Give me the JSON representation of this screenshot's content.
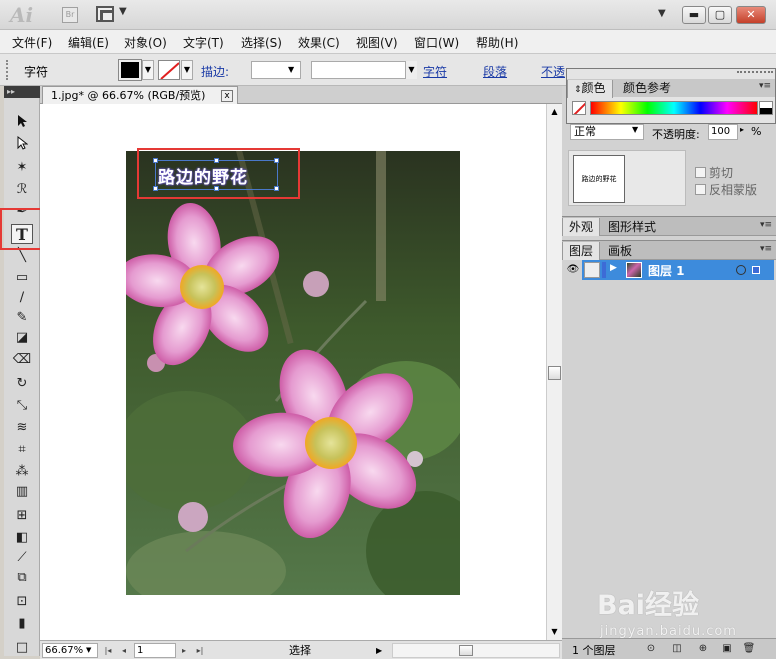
{
  "app": {
    "logo": "Ai",
    "bridge_label": "Br"
  },
  "menu": [
    "文件(F)",
    "编辑(E)",
    "对象(O)",
    "文字(T)",
    "选择(S)",
    "效果(C)",
    "视图(V)",
    "窗口(W)",
    "帮助(H)"
  ],
  "controlbar": {
    "label": "字符",
    "stroke_label": "描边:",
    "char_link": "字符",
    "para_link": "段落",
    "opacity_link": "不透"
  },
  "document": {
    "tab_title": "1.jpg* @ 66.67% (RGB/预览)",
    "close_glyph": "x",
    "text_object": "路边的野花"
  },
  "statusbar": {
    "zoom": "66.67%",
    "page": "1",
    "tool": "选择"
  },
  "panels": {
    "color_tabs": [
      "颜色",
      "颜色参考"
    ],
    "transparency": {
      "blend_mode": "正常",
      "opacity_label": "不透明度:",
      "opacity_value": "100",
      "opacity_unit": "%",
      "mask_preview_text": "路边的野花",
      "clip_label": "剪切",
      "invert_label": "反相蒙版"
    },
    "appearance_tabs": [
      "外观",
      "图形样式"
    ],
    "layer_tabs": [
      "图层",
      "画板"
    ],
    "layers": [
      {
        "name": "图层 1"
      }
    ],
    "layer_count": "1 个图层"
  },
  "watermark": {
    "brand": "Bai经验",
    "site": "jingyan.baidu.com"
  },
  "colors": {
    "highlight": "#e53935",
    "selection": "#3d8bdc",
    "link": "#1a3aa6"
  },
  "icons": [
    "selection-tool-icon",
    "direct-select-icon",
    "magic-wand-icon",
    "lasso-icon",
    "pen-icon",
    "type-tool-icon",
    "line-tool-icon",
    "rectangle-tool-icon",
    "paintbrush-icon",
    "pencil-icon",
    "blob-brush-icon",
    "eraser-icon",
    "rotate-icon",
    "scale-icon",
    "warp-icon",
    "free-transform-icon",
    "symbol-sprayer-icon",
    "graph-icon",
    "mesh-icon",
    "gradient-icon",
    "eyedropper-icon",
    "blend-icon",
    "slice-icon",
    "hand-icon",
    "eye-icon"
  ]
}
